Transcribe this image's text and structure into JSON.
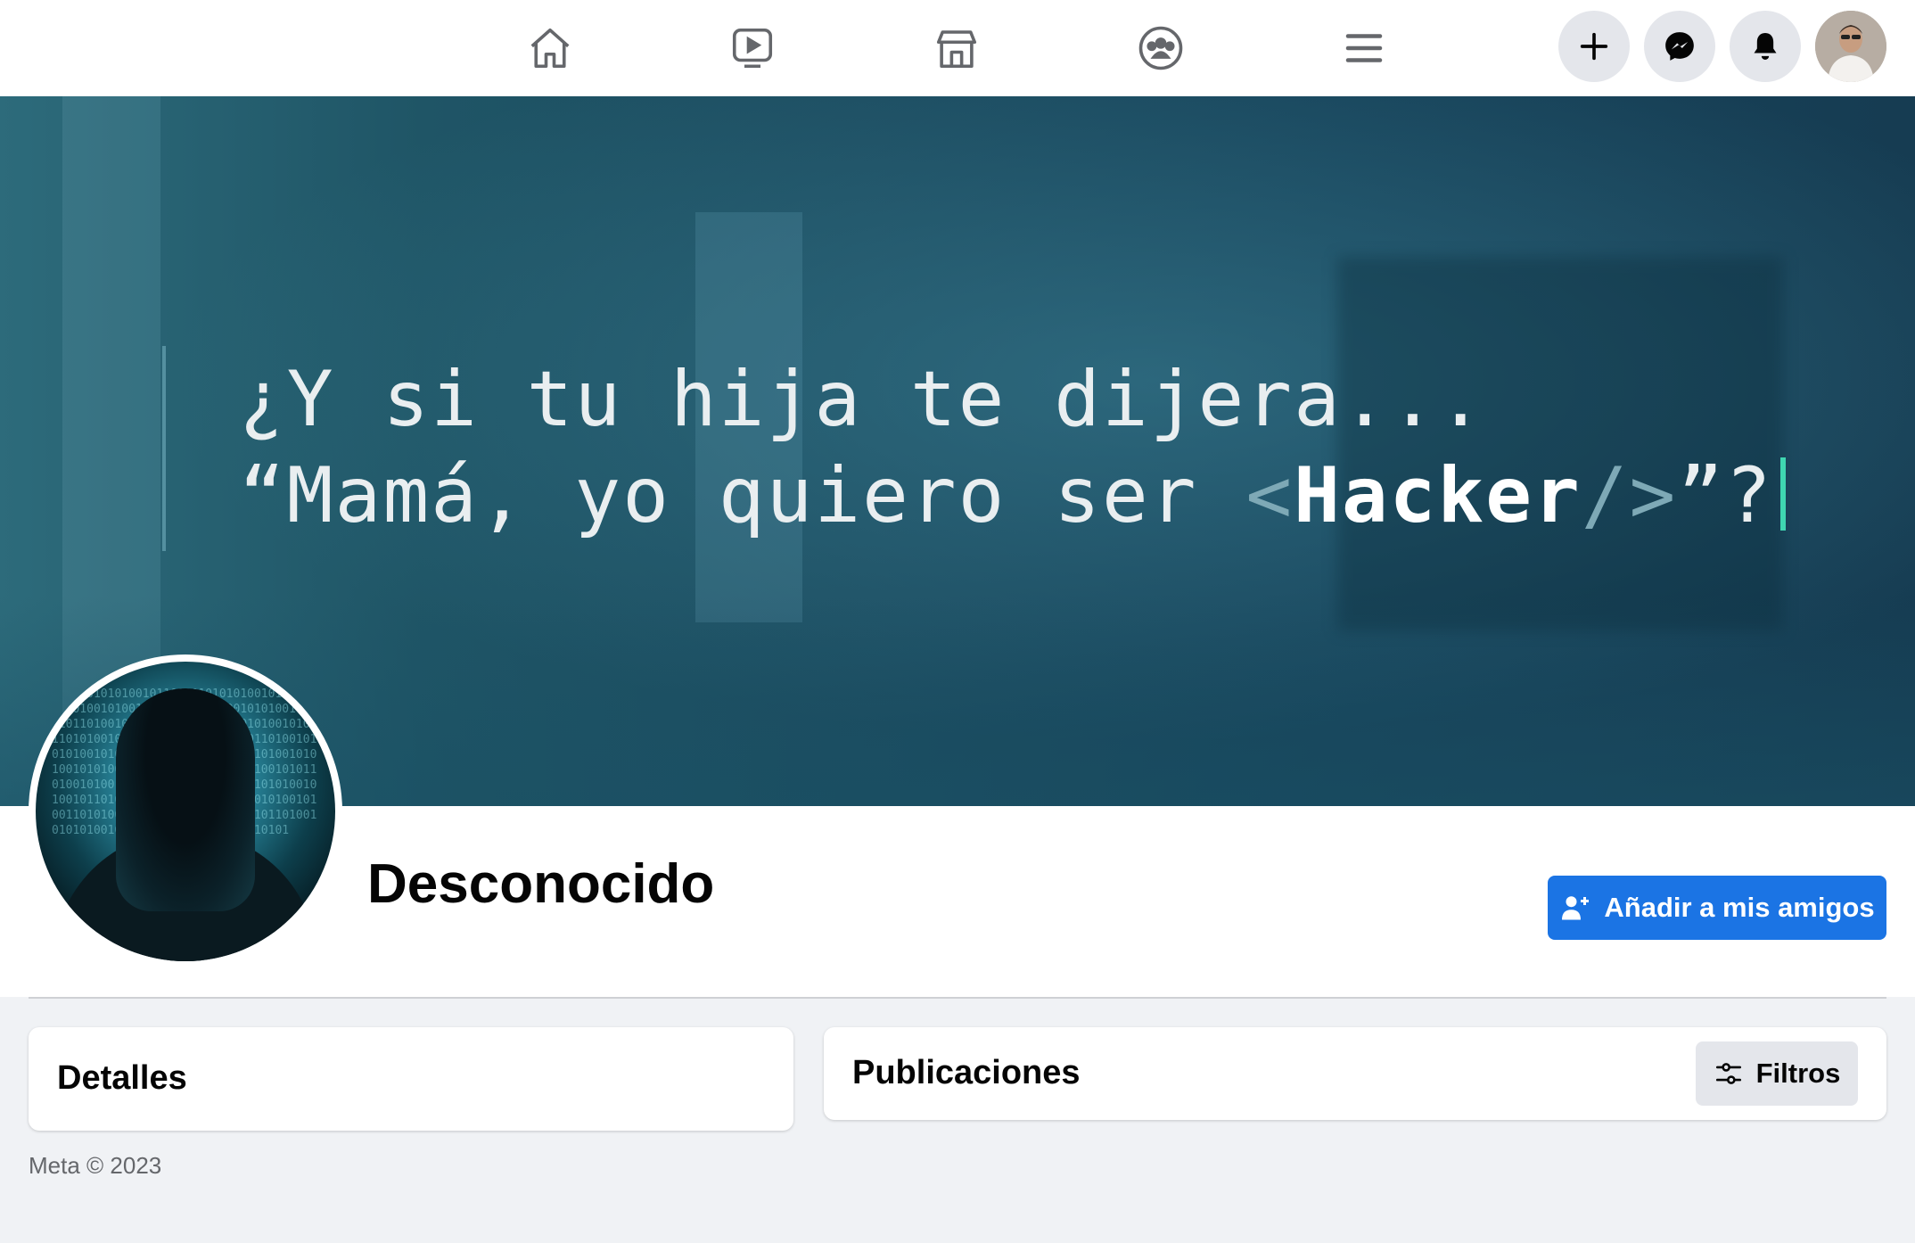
{
  "nav": {
    "icons": [
      "home-icon",
      "watch-icon",
      "marketplace-icon",
      "groups-icon",
      "menu-icon"
    ],
    "right_buttons": [
      "create-icon",
      "messenger-icon",
      "notifications-icon"
    ]
  },
  "cover": {
    "line1": "¿Y si tu hija te dijera...",
    "line2_pre": "“Mamá, yo quiero ser ",
    "line2_lt": "<",
    "line2_bold": "Hacker",
    "line2_tag": "/>",
    "line2_post": "”?"
  },
  "profile": {
    "name": "Desconocido",
    "add_friend_label": "Añadir a mis amigos"
  },
  "details": {
    "title": "Detalles"
  },
  "posts": {
    "title": "Publicaciones",
    "filters_label": "Filtros"
  },
  "footer": {
    "text": "Meta © 2023"
  },
  "colors": {
    "primary": "#1b74e4",
    "background": "#f0f2f5",
    "cursor": "#3fd6b1"
  }
}
